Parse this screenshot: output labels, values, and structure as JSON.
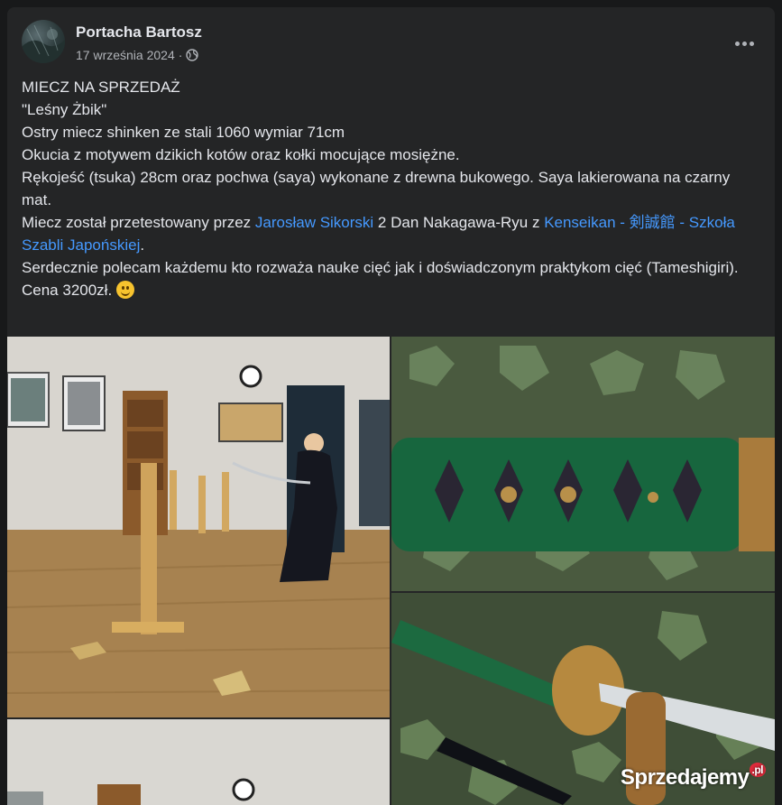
{
  "post": {
    "author": "Portacha Bartosz",
    "date": "17 września 2024",
    "separator": "·",
    "privacy_icon": "globe-icon",
    "menu_icon": "more-options-icon"
  },
  "content": {
    "line1": "MIECZ NA SPRZEDAŻ",
    "line2": "\"Leśny Żbik\"",
    "line3": "Ostry miecz shinken ze stali 1060 wymiar 71cm",
    "line4": "Okucia z motywem dzikich kotów oraz kołki mocujące mosiężne.",
    "line5": "Rękojeść (tsuka) 28cm oraz pochwa (saya) wykonane z drewna bukowego. Saya lakierowana na czarny mat.",
    "line6_a": "Miecz został przetestowany przez ",
    "line6_link1": "Jarosław Sikorski",
    "line6_b": " 2 Dan Nakagawa-Ryu z ",
    "line6_link2": "Kenseikan - 剣誠館 - Szkoła Szabli Japońskiej",
    "line6_c": ".",
    "line7": "Serdecznie polecam każdemu kto rozważa nauke cięć jak i doświadczonym praktykom cięć (Tameshigiri).",
    "line8": "Cena 3200zł.",
    "emoji": "smile-emoji"
  },
  "photos": {
    "watermark_name": "Sprzedajemy",
    "watermark_tld": ".pl"
  },
  "colors": {
    "card_bg": "#242526",
    "page_bg": "#18191a",
    "link": "#4599ff",
    "text": "#e4e6eb",
    "secondary_text": "#b0b3b8"
  }
}
